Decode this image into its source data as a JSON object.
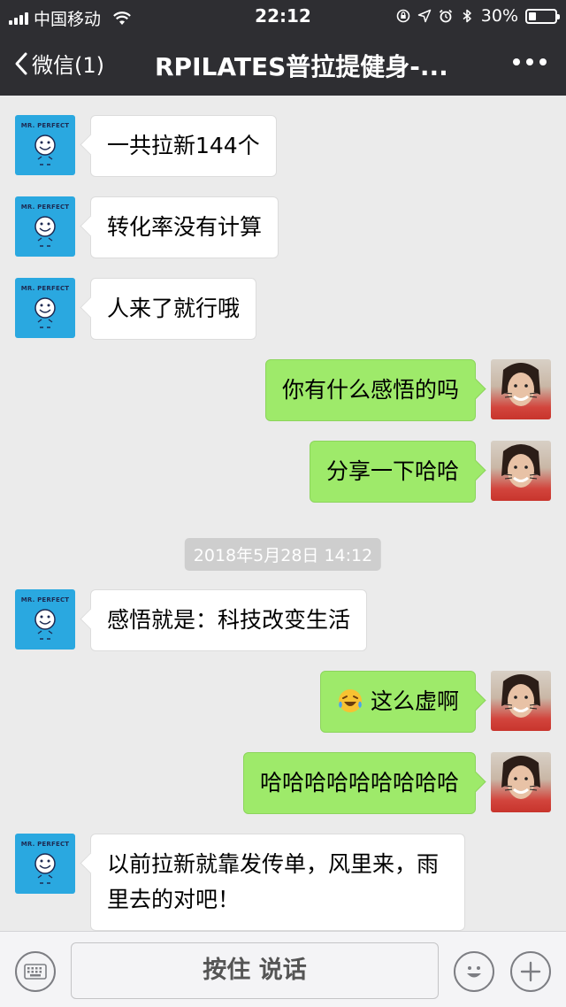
{
  "status_bar": {
    "carrier": "中国移动",
    "time": "22:12",
    "battery_percent": "30%",
    "battery_level": 0.3,
    "icons": [
      "signal-icon",
      "wifi-icon",
      "screen-lock-icon",
      "location-icon",
      "alarm-icon",
      "bluetooth-icon",
      "battery-icon"
    ]
  },
  "nav": {
    "back_label": "微信(1)",
    "title": "RPILATES普拉提健身-...",
    "more_icon": "more-icon"
  },
  "avatars": {
    "contact_label": "MR. PERFECT"
  },
  "messages": [
    {
      "side": "left",
      "text": "一共拉新144个"
    },
    {
      "side": "left",
      "text": "转化率没有计算"
    },
    {
      "side": "left",
      "text": "人来了就行哦"
    },
    {
      "side": "right",
      "text": "你有什么感悟的吗"
    },
    {
      "side": "right",
      "text": "分享一下哈哈"
    },
    {
      "type": "timestamp",
      "text": "2018年5月28日 14:12"
    },
    {
      "side": "left",
      "text": "感悟就是：科技改变生活"
    },
    {
      "side": "right",
      "text": "这么虚啊",
      "emoji": "laughing-crying-emoji"
    },
    {
      "side": "right",
      "text": "哈哈哈哈哈哈哈哈哈"
    },
    {
      "side": "left",
      "text": "以前拉新就靠发传单，风里来，雨里去的对吧！"
    }
  ],
  "input_bar": {
    "hold_to_talk_label": "按住 说话",
    "icons": [
      "keyboard-icon",
      "emoji-icon",
      "plus-icon"
    ]
  },
  "colors": {
    "bar_bg": "#2e2e32",
    "chat_bg": "#ebebeb",
    "bubble_mine": "#9eea6a",
    "bubble_theirs": "#ffffff",
    "avatar_contact": "#2aa8e0"
  }
}
